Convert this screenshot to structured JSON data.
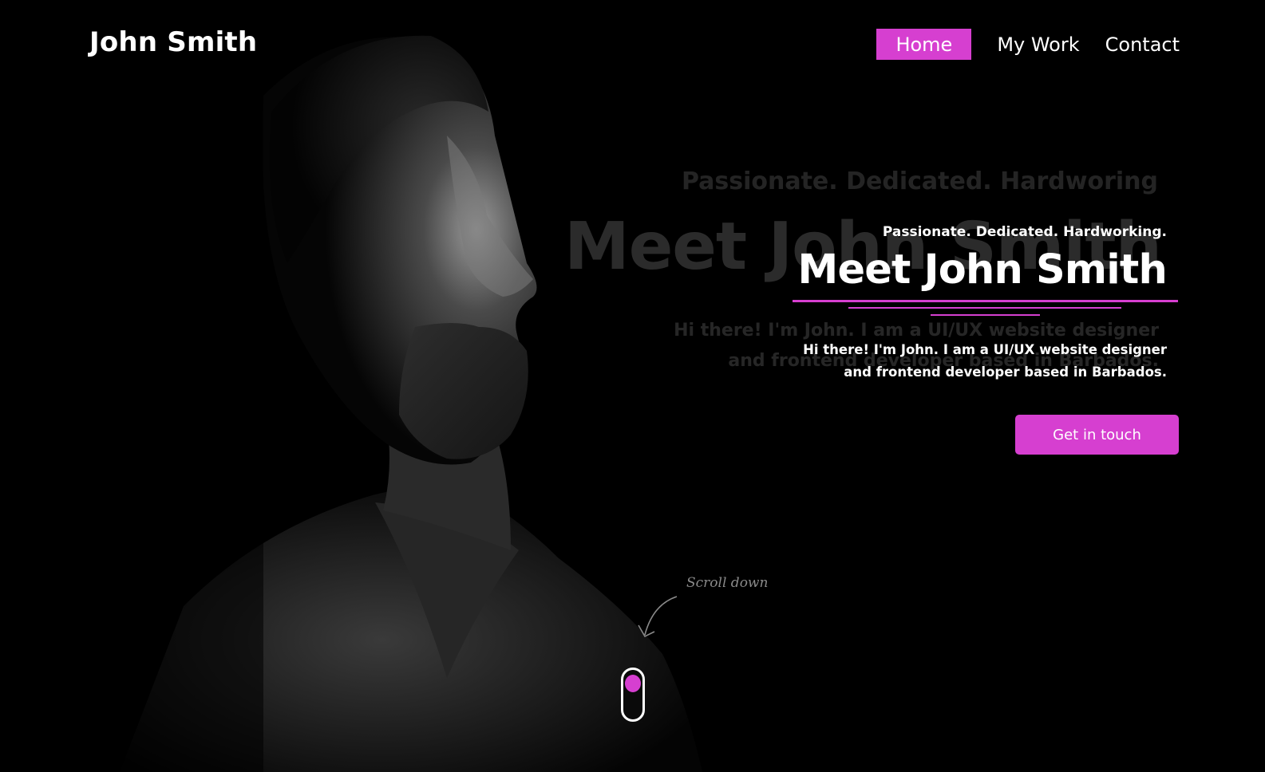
{
  "brand": {
    "name": "John Smith"
  },
  "nav": {
    "items": [
      {
        "label": "Home",
        "active": true
      },
      {
        "label": "My Work",
        "active": false
      },
      {
        "label": "Contact",
        "active": false
      }
    ]
  },
  "hero": {
    "tagline": "Passionate. Dedicated. Hardworking.",
    "title": "Meet John Smith",
    "intro_line_1": "Hi there! I'm John. I am a UI/UX website designer",
    "intro_line_2": "and frontend developer based in Barbados.",
    "cta_label": "Get in touch",
    "ghost_tagline": "Passionate. Dedicated. Hardworing",
    "ghost_title": "Meet John Smith",
    "ghost_intro_line_1": "Hi there! I'm John. I am a UI/UX website designer",
    "ghost_intro_line_2": "and frontend developer based in Barbados."
  },
  "scroll": {
    "hint": "Scroll down"
  },
  "colors": {
    "accent": "#d63fd0",
    "background": "#000000",
    "text": "#ffffff"
  },
  "icons": {
    "scroll_arrow": "curved-arrow-icon",
    "mouse": "mouse-scroll-icon"
  }
}
